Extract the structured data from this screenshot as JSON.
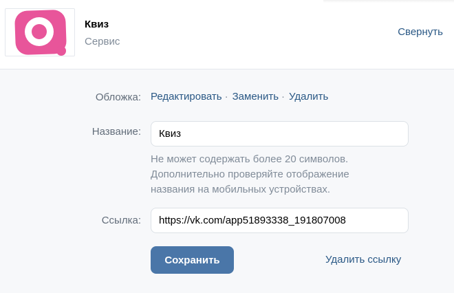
{
  "header": {
    "app_title": "Квиз",
    "app_subtitle": "Сервис",
    "collapse_label": "Свернуть",
    "icon": "app-logo-icon",
    "brand_color": "#e8559a"
  },
  "cover": {
    "label": "Обложка:",
    "edit_label": "Редактировать",
    "replace_label": "Заменить",
    "delete_label": "Удалить",
    "separator": "·"
  },
  "name": {
    "label": "Название:",
    "value": "Квиз",
    "hint": "Не может содержать более 20 символов. Дополнительно проверяйте отображение названия на мобильных устройствах."
  },
  "link": {
    "label": "Ссылка:",
    "value": "https://vk.com/app51893338_191807008"
  },
  "actions": {
    "save_label": "Сохранить",
    "delete_link_label": "Удалить ссылку",
    "accent_color": "#4a76a8",
    "link_color": "#2a5885"
  }
}
